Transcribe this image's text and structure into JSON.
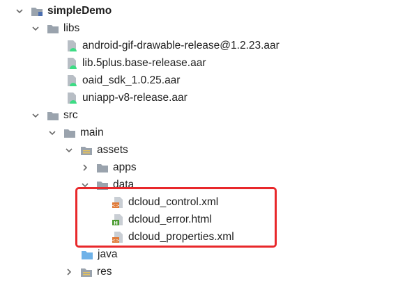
{
  "tree": {
    "module": "simpleDemo",
    "libs": {
      "label": "libs",
      "files": [
        "android-gif-drawable-release@1.2.23.aar",
        "lib.5plus.base-release.aar",
        "oaid_sdk_1.0.25.aar",
        "uniapp-v8-release.aar"
      ]
    },
    "src": "src",
    "main": "main",
    "assets": "assets",
    "apps": "apps",
    "data": "data",
    "data_files": [
      "dcloud_control.xml",
      "dcloud_error.html",
      "dcloud_properties.xml"
    ],
    "java": "java",
    "res": "res"
  },
  "colors": {
    "highlight_border": "#e8282b",
    "folder": "#9aa3ad",
    "xml_badge": "#e07b39",
    "html_badge": "#4a9b2f",
    "aar_badge": "#3ddc84",
    "java_folder": "#6fb2e8"
  }
}
